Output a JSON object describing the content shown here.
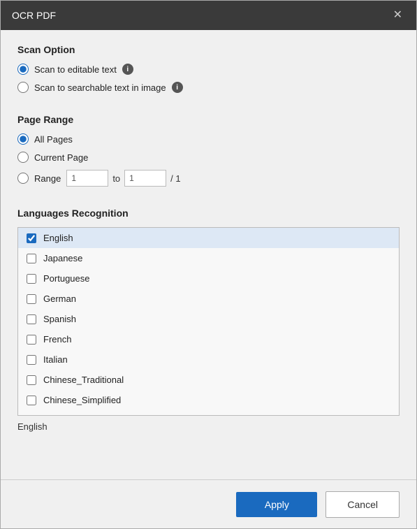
{
  "titleBar": {
    "title": "OCR PDF",
    "closeLabel": "✕"
  },
  "scanOption": {
    "sectionTitle": "Scan Option",
    "option1": {
      "label": "Scan to editable text",
      "checked": true
    },
    "option2": {
      "label": "Scan to searchable text in image",
      "checked": false
    }
  },
  "pageRange": {
    "sectionTitle": "Page Range",
    "allPages": {
      "label": "All Pages",
      "checked": true
    },
    "currentPage": {
      "label": "Current Page",
      "checked": false
    },
    "range": {
      "label": "Range",
      "checked": false,
      "fromValue": "1",
      "toValue": "1",
      "totalLabel": "/ 1",
      "toLabelText": "to"
    }
  },
  "languagesRecognition": {
    "sectionTitle": "Languages Recognition",
    "languages": [
      {
        "name": "English",
        "checked": true
      },
      {
        "name": "Japanese",
        "checked": false
      },
      {
        "name": "Portuguese",
        "checked": false
      },
      {
        "name": "German",
        "checked": false
      },
      {
        "name": "Spanish",
        "checked": false
      },
      {
        "name": "French",
        "checked": false
      },
      {
        "name": "Italian",
        "checked": false
      },
      {
        "name": "Chinese_Traditional",
        "checked": false
      },
      {
        "name": "Chinese_Simplified",
        "checked": false
      }
    ],
    "selectedText": "English"
  },
  "footer": {
    "applyLabel": "Apply",
    "cancelLabel": "Cancel"
  }
}
